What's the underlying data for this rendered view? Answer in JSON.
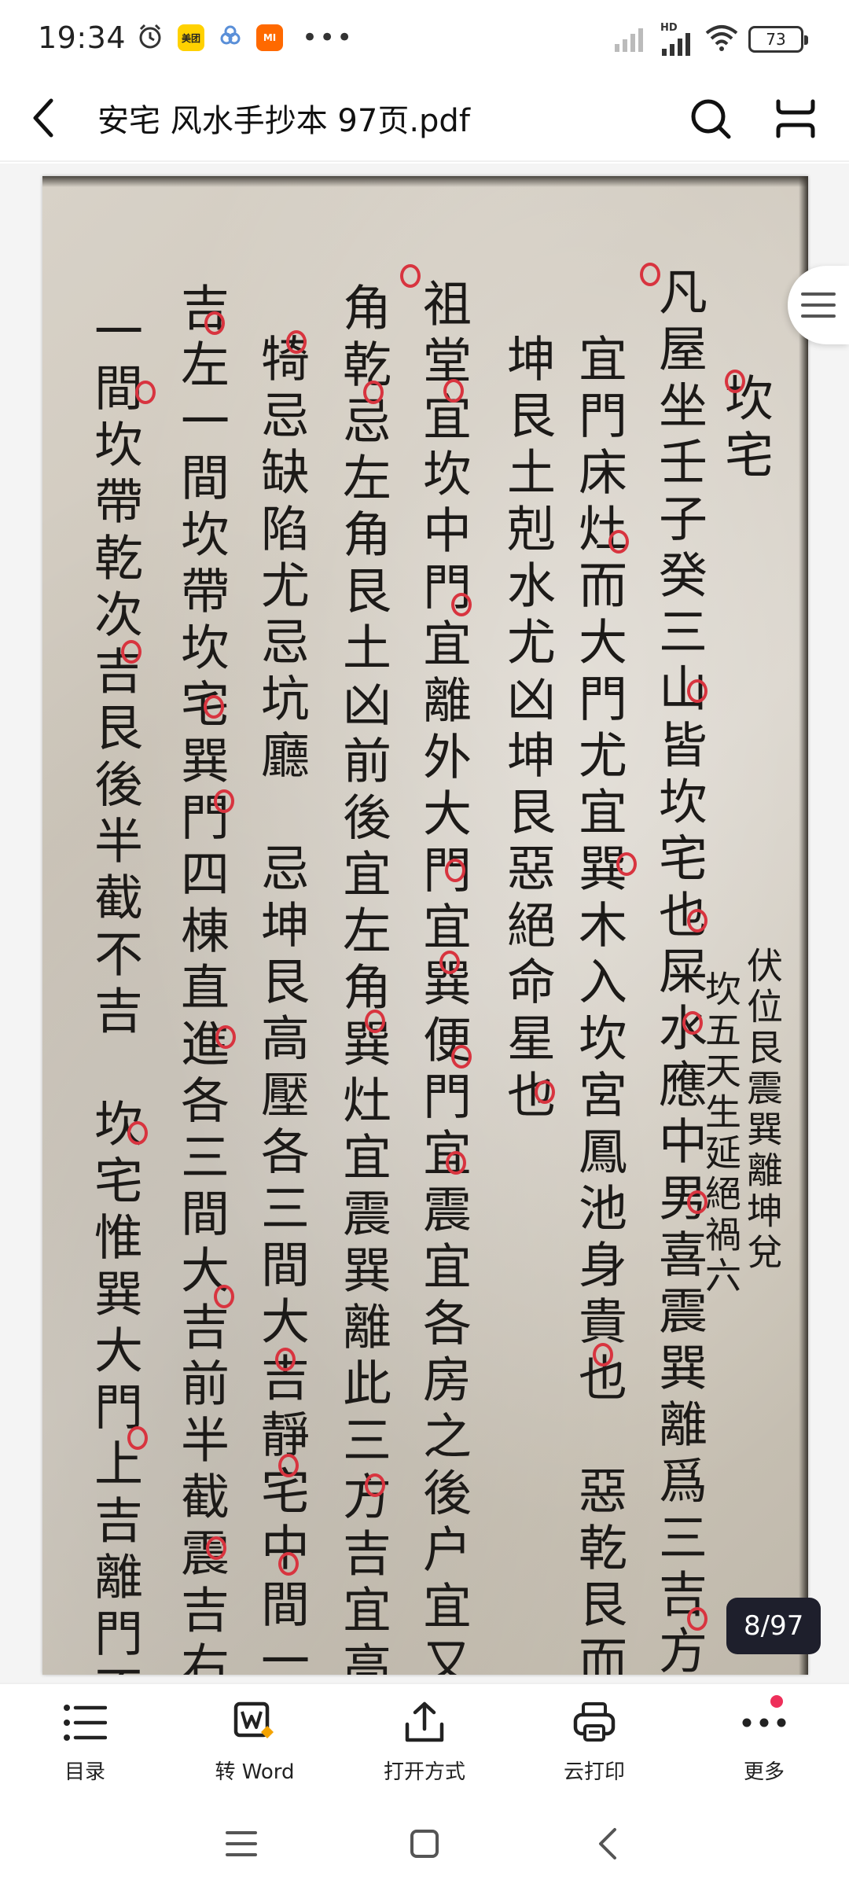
{
  "status_bar": {
    "time": "19:34",
    "app_badges": [
      "美团",
      "MI"
    ],
    "more_dots": "•••",
    "network_label": "HD",
    "battery_level": "73"
  },
  "title_bar": {
    "title": "安宅 风水手抄本 97页.pdf",
    "icons": [
      "back-icon",
      "search-icon",
      "fullscreen-icon"
    ]
  },
  "document": {
    "columns": [
      "坎宅",
      "凡屋坐壬子癸三山皆坎宅也屎水應中男喜震巽離爲三吉方",
      "宜門床灶而大門尤宜巽木入坎宮鳳池身貴也　惡乾艮而",
      "坤艮土剋水尤凶坤艮惡絕命星也",
      "祖堂宜坎中門宜離外大門宜巽便門宜震宜各房之後户宜又",
      "角乾忌左角艮土凶前後宜左角巽灶宜震巽離此三方吉宜高",
      "犄忌缺陷尤忌坑廳　忌坤艮高壓各三間大吉靜宅中間一",
      "吉左一間坎帶坎宅巽門四棟直進各三間大吉前半截震吉右",
      "一間坎帶乾次吉艮後半截不吉　坎宅惟巽大門上吉離門不"
    ],
    "margin_note": [
      "伏位艮震巽離坤兌",
      "坎五天生延絕禍六"
    ]
  },
  "viewer": {
    "page_counter": "8/97",
    "outline_icon": "list-icon"
  },
  "toolbar": {
    "items": [
      {
        "label": "目录",
        "icon": "list-icon"
      },
      {
        "label": "转 Word",
        "icon": "word-convert-icon"
      },
      {
        "label": "打开方式",
        "icon": "share-icon"
      },
      {
        "label": "云打印",
        "icon": "printer-icon"
      },
      {
        "label": "更多",
        "icon": "more-icon"
      }
    ]
  },
  "nav_bar": {
    "icons": [
      "menu-icon",
      "home-icon",
      "back-icon"
    ]
  },
  "colors": {
    "accent_dark": "#1e1f2c",
    "red_mark": "#d8343f",
    "notification": "#ee2f5a",
    "paper": "#d3cdc2"
  }
}
